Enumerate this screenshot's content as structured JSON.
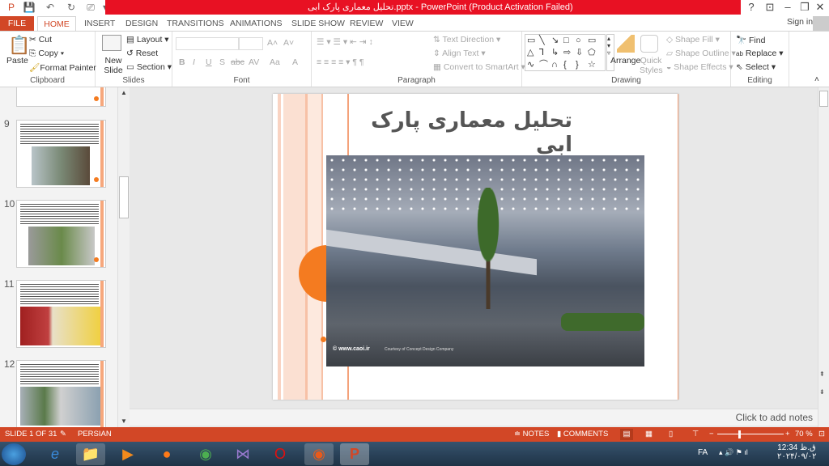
{
  "window": {
    "title": "تحلیل معماری پارک ابی.pptx - PowerPoint (Product Activation Failed)",
    "help": "?",
    "restore_ribbon": "⊡",
    "minimize": "–",
    "maximize": "❐",
    "close": "✕",
    "sign_in": "Sign in"
  },
  "tabs": [
    "FILE",
    "HOME",
    "INSERT",
    "DESIGN",
    "TRANSITIONS",
    "ANIMATIONS",
    "SLIDE SHOW",
    "REVIEW",
    "VIEW"
  ],
  "ribbon": {
    "clipboard": {
      "label": "Clipboard",
      "paste": "Paste",
      "cut": "Cut",
      "copy": "Copy",
      "format_painter": "Format Painter"
    },
    "slides": {
      "label": "Slides",
      "new_slide": "New Slide",
      "layout": "Layout",
      "reset": "Reset",
      "section": "Section"
    },
    "font": {
      "label": "Font",
      "bold": "B",
      "italic": "I",
      "underline": "U",
      "strike": "S",
      "abc": "abc",
      "spacing": "AV",
      "case": "Aa",
      "color": "A",
      "grow": "A˄",
      "shrink": "A˅"
    },
    "paragraph": {
      "label": "Paragraph",
      "text_direction": "Text Direction",
      "align_text": "Align Text",
      "convert_smartart": "Convert to SmartArt"
    },
    "drawing": {
      "label": "Drawing",
      "arrange": "Arrange",
      "quick_styles": "Quick Styles",
      "shape_fill": "Shape Fill",
      "shape_outline": "Shape Outline",
      "shape_effects": "Shape Effects",
      "shapes": [
        "▭",
        "╲",
        "↘",
        "□",
        "○",
        "▭",
        "△",
        "⅂",
        "↳",
        "⇨",
        "⇩",
        "⬠",
        "∿",
        "⌒",
        "∩",
        "{",
        "}",
        "☆"
      ]
    },
    "editing": {
      "label": "Editing",
      "find": "Find",
      "replace": "Replace",
      "select": "Select"
    }
  },
  "thumbnails": [
    {
      "num": "9"
    },
    {
      "num": "10"
    },
    {
      "num": "11"
    },
    {
      "num": "12"
    }
  ],
  "slide": {
    "title": "تحلیل معماری پارک ابی",
    "photo_credit": "© www.caoi.ir",
    "photo_caption": "Courtesy of Concept Design Company"
  },
  "notes_placeholder": "Click to add notes",
  "status": {
    "slide": "SLIDE 1 OF 31",
    "language": "PERSIAN",
    "notes": "NOTES",
    "comments": "COMMENTS",
    "zoom": "70 %",
    "zoom_percent": 70
  },
  "taskbar": {
    "lang": "FA",
    "time": "12:34 ق.ظ",
    "date": "۲۰۲۴/۰۹/۰۲"
  },
  "colors": {
    "accent": "#d24726",
    "title_bar": "#e81123",
    "slide_accent": "#f47b20"
  }
}
